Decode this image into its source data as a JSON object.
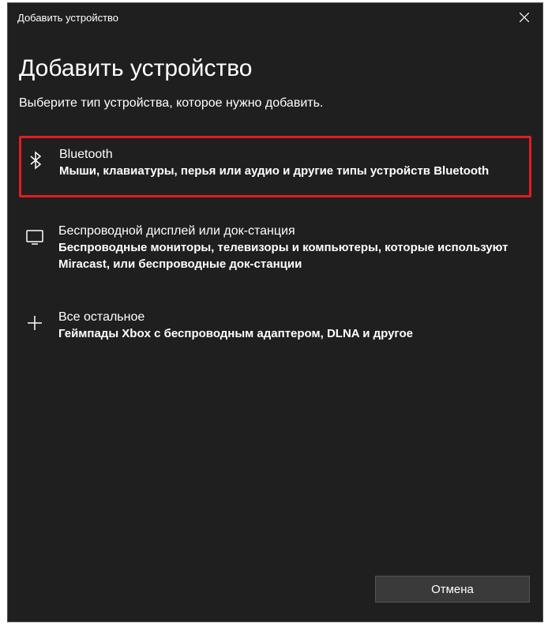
{
  "titlebar": {
    "title": "Добавить устройство"
  },
  "main": {
    "heading": "Добавить устройство",
    "subheading": "Выберите тип устройства, которое нужно добавить."
  },
  "options": {
    "bluetooth": {
      "title": "Bluetooth",
      "description": "Мыши, клавиатуры, перья или аудио и другие типы устройств Bluetooth"
    },
    "wireless_display": {
      "title": "Беспроводной дисплей или док-станция",
      "description": "Беспроводные мониторы, телевизоры и компьютеры, которые используют Miracast, или беспроводные док-станции"
    },
    "everything_else": {
      "title": "Все остальное",
      "description": "Геймпады Xbox с беспроводным адаптером, DLNA и другое"
    }
  },
  "footer": {
    "cancel_label": "Отмена"
  }
}
